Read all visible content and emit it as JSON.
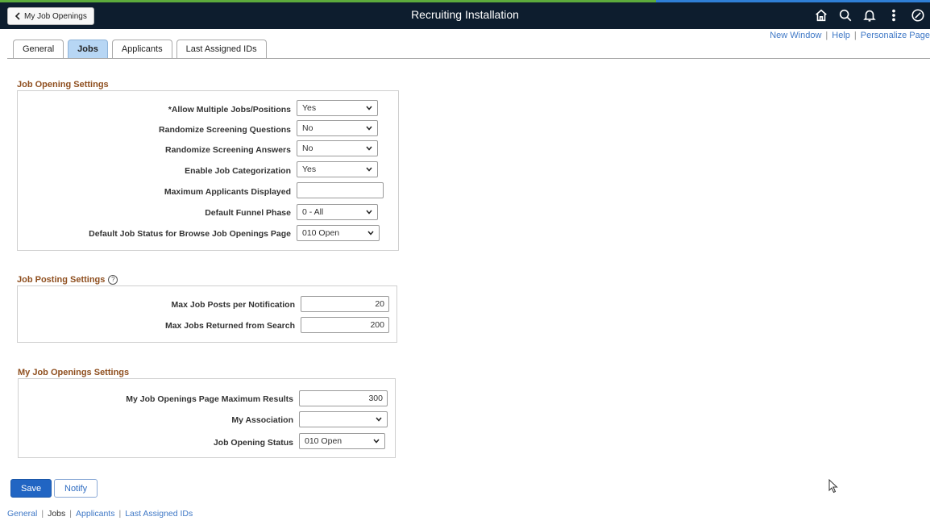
{
  "header": {
    "back_label": "My Job Openings",
    "title": "Recruiting Installation",
    "icons": [
      "home-icon",
      "search-icon",
      "bell-icon",
      "more-icon",
      "compass-icon"
    ]
  },
  "top_links": {
    "new_window": "New Window",
    "help": "Help",
    "personalize": "Personalize Page"
  },
  "tabs": [
    {
      "label": "General",
      "active": false
    },
    {
      "label": "Jobs",
      "active": true
    },
    {
      "label": "Applicants",
      "active": false
    },
    {
      "label": "Last Assigned IDs",
      "active": false
    }
  ],
  "job_opening_settings": {
    "title": "Job Opening Settings",
    "fields": {
      "allow_multiple": {
        "label": "*Allow Multiple Jobs/Positions",
        "value": "Yes"
      },
      "randomize_questions": {
        "label": "Randomize Screening Questions",
        "value": "No"
      },
      "randomize_answers": {
        "label": "Randomize Screening Answers",
        "value": "No"
      },
      "enable_categorization": {
        "label": "Enable Job Categorization",
        "value": "Yes"
      },
      "max_applicants": {
        "label": "Maximum Applicants Displayed",
        "value": ""
      },
      "default_funnel": {
        "label": "Default Funnel Phase",
        "value": "0 - All"
      },
      "default_status": {
        "label": "Default Job Status for Browse Job Openings Page",
        "value": "010 Open"
      }
    }
  },
  "job_posting_settings": {
    "title": "Job Posting Settings",
    "fields": {
      "max_posts": {
        "label": "Max Job Posts per Notification",
        "value": "20"
      },
      "max_returned": {
        "label": "Max Jobs Returned from Search",
        "value": "200"
      }
    }
  },
  "my_job_openings_settings": {
    "title": "My Job Openings Settings",
    "fields": {
      "max_results": {
        "label": "My Job Openings Page Maximum Results",
        "value": "300"
      },
      "association": {
        "label": "My Association",
        "value": ""
      },
      "status": {
        "label": "Job Opening Status",
        "value": "010 Open"
      }
    }
  },
  "actions": {
    "save": "Save",
    "notify": "Notify"
  },
  "bottom_links": {
    "general": "General",
    "jobs": "Jobs",
    "applicants": "Applicants",
    "last_ids": "Last Assigned IDs"
  },
  "colors": {
    "header_bg": "#0d1d2e",
    "section_title": "#8f4f1f",
    "link": "#3f78c6",
    "primary_button": "#2165c3",
    "active_tab": "#b7d6f4"
  }
}
